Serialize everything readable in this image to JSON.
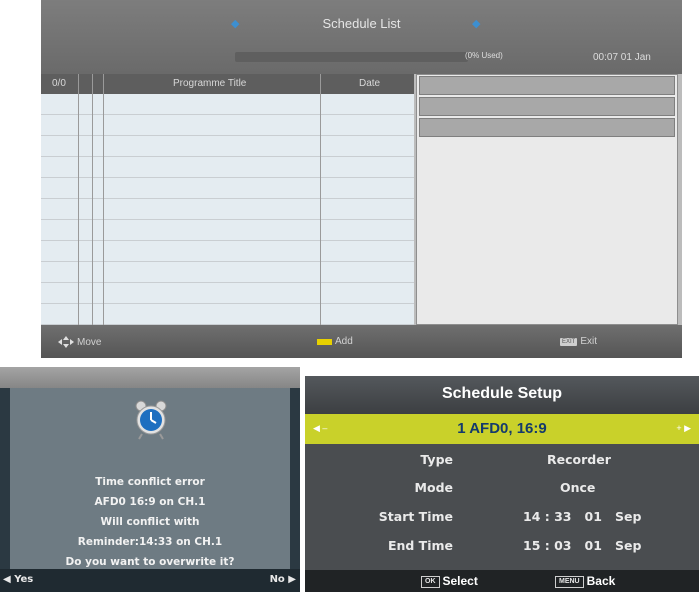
{
  "schedule_list": {
    "title": "Schedule List",
    "usage_text": "(0% Used)",
    "clock": "00:07 01 Jan",
    "columns": {
      "index": "0/0",
      "programme_title": "Programme Title",
      "date": "Date"
    },
    "footer": {
      "move": "Move",
      "add": "Add",
      "exit_key": "EXIT",
      "exit": "Exit"
    }
  },
  "conflict_dialog": {
    "lines": [
      "Time conflict error",
      "AFD0 16:9 on CH.1",
      "Will conflict with",
      "Reminder:14:33 on CH.1",
      "Do you want to overwrite it?"
    ],
    "yes_label": "Yes",
    "no_label": "No",
    "icon": "alarm-clock-icon"
  },
  "schedule_setup": {
    "title": "Schedule Setup",
    "channel": "1 AFD0, 16:9",
    "rows": [
      {
        "label": "Type",
        "value": "Recorder"
      },
      {
        "label": "Mode",
        "value": "Once"
      },
      {
        "label": "Start Time",
        "value": "14 : 33   01   Sep"
      },
      {
        "label": "End Time",
        "value": "15 : 03   01   Sep"
      }
    ],
    "footer": {
      "ok_key": "OK",
      "select": "Select",
      "menu_key": "MENU",
      "back": "Back"
    }
  },
  "colors": {
    "highlight": "#c9d12a",
    "channel_text": "#143a6c",
    "arrow_blue": "#3d8fd0",
    "yellow_key": "#e8d100"
  }
}
